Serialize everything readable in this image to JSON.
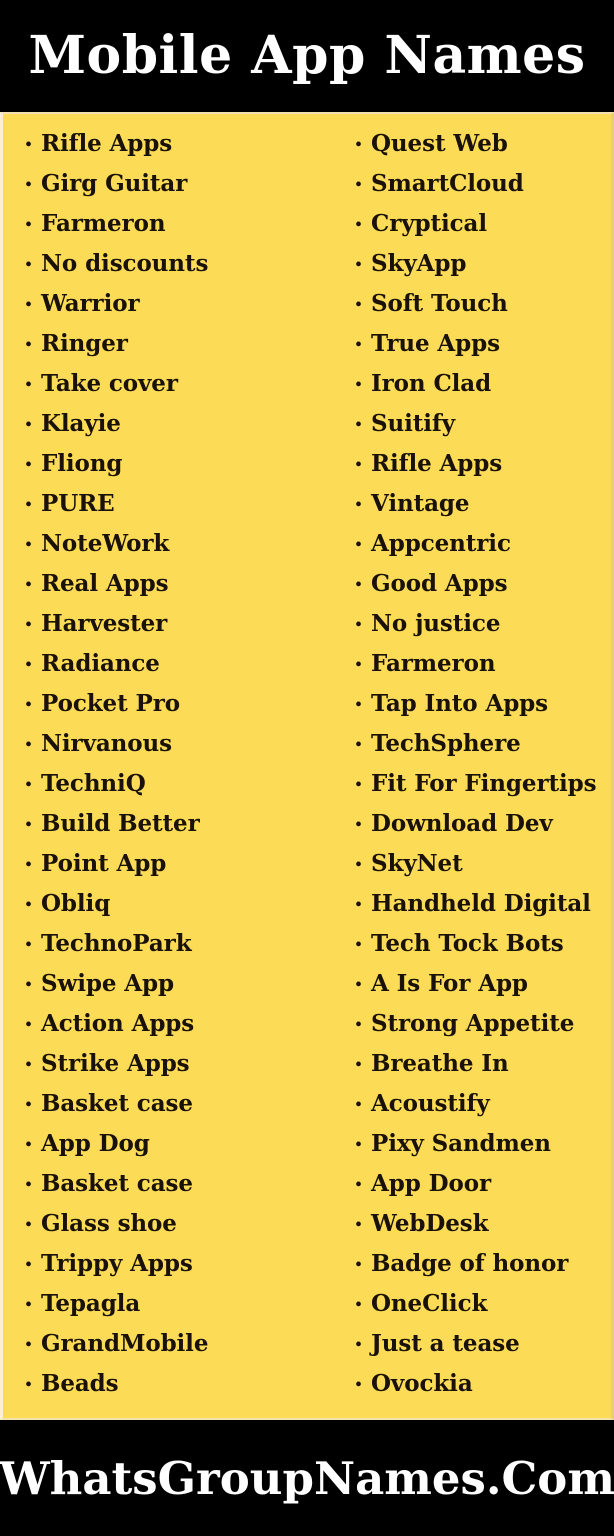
{
  "header": {
    "title": "Mobile App Names"
  },
  "colors": {
    "panel_background": "#FCDC57",
    "header_background": "#000000",
    "header_text": "#FFFFFF",
    "item_text": "#1A1208",
    "bullet": "#1A1208"
  },
  "bullet_glyph": "•",
  "list": {
    "left_column": [
      {
        "label": "Rifle Apps"
      },
      {
        "label": "Girg Guitar"
      },
      {
        "label": "Farmeron"
      },
      {
        "label": "No discounts"
      },
      {
        "label": "Warrior"
      },
      {
        "label": "Ringer"
      },
      {
        "label": "Take cover"
      },
      {
        "label": "Klayie"
      },
      {
        "label": "Fliong"
      },
      {
        "label": "PURE"
      },
      {
        "label": "NoteWork"
      },
      {
        "label": "Real Apps"
      },
      {
        "label": "Harvester"
      },
      {
        "label": "Radiance"
      },
      {
        "label": "Pocket Pro"
      },
      {
        "label": "Nirvanous"
      },
      {
        "label": "TechniQ"
      },
      {
        "label": "Build Better"
      },
      {
        "label": "Point App"
      },
      {
        "label": "Obliq"
      },
      {
        "label": "TechnoPark"
      },
      {
        "label": "Swipe App"
      },
      {
        "label": "Action Apps"
      },
      {
        "label": "Strike Apps"
      },
      {
        "label": "Basket case"
      },
      {
        "label": "App Dog"
      },
      {
        "label": "Basket case"
      },
      {
        "label": "Glass shoe"
      },
      {
        "label": "Trippy Apps"
      },
      {
        "label": "Tepagla"
      },
      {
        "label": "GrandMobile"
      },
      {
        "label": "Beads"
      }
    ],
    "right_column": [
      {
        "label": "Quest Web"
      },
      {
        "label": "SmartCloud"
      },
      {
        "label": "Cryptical"
      },
      {
        "label": "SkyApp"
      },
      {
        "label": "Soft Touch"
      },
      {
        "label": "True Apps"
      },
      {
        "label": "Iron Clad"
      },
      {
        "label": "Suitify"
      },
      {
        "label": "Rifle Apps"
      },
      {
        "label": "Vintage"
      },
      {
        "label": "Appcentric"
      },
      {
        "label": "Good Apps"
      },
      {
        "label": "No justice"
      },
      {
        "label": "Farmeron"
      },
      {
        "label": "Tap Into Apps"
      },
      {
        "label": "TechSphere"
      },
      {
        "label": "Fit For Fingertips"
      },
      {
        "label": "Download Dev"
      },
      {
        "label": "SkyNet"
      },
      {
        "label": "Handheld Digital"
      },
      {
        "label": "Tech Tock Bots"
      },
      {
        "label": "A Is For App"
      },
      {
        "label": "Strong Appetite"
      },
      {
        "label": "Breathe In"
      },
      {
        "label": "Acoustify"
      },
      {
        "label": "Pixy Sandmen"
      },
      {
        "label": "App Door"
      },
      {
        "label": "WebDesk"
      },
      {
        "label": "Badge of honor"
      },
      {
        "label": "OneClick"
      },
      {
        "label": "Just a tease"
      },
      {
        "label": "Ovockia"
      }
    ]
  },
  "footer": {
    "title": "WhatsGroupNames.Com"
  }
}
